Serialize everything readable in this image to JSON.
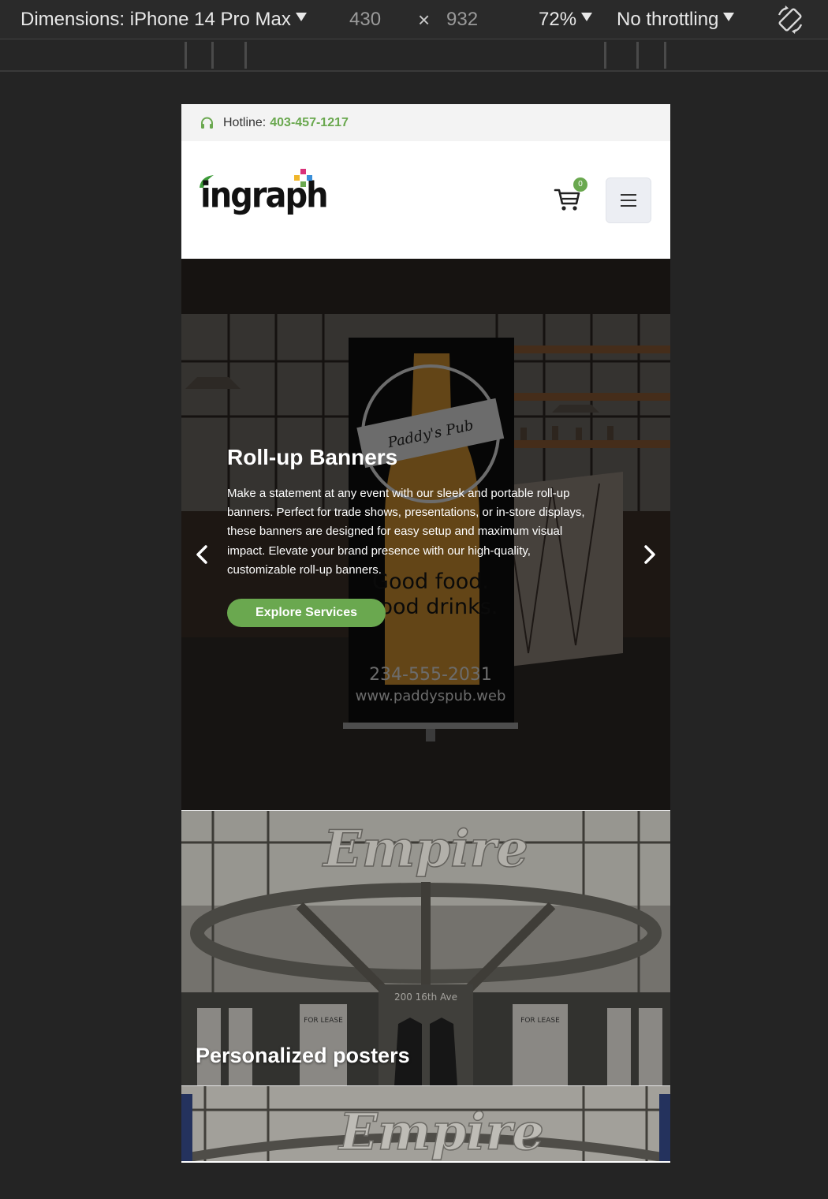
{
  "devtools": {
    "dimensions_label": "Dimensions: iPhone 14 Pro Max",
    "width": "430",
    "times": "×",
    "height": "932",
    "zoom": "72%",
    "throttling": "No throttling"
  },
  "site": {
    "hotline_label": "Hotline:",
    "hotline_number": "403-457-1217",
    "logo_text": "ingraph",
    "cart_count": "0",
    "colors": {
      "accent": "#6aa84f",
      "topbar_bg": "#f3f3f3"
    }
  },
  "hero": {
    "title": "Roll-up Banners",
    "description": "Make a statement at any event with our sleek and portable roll-up banners. Perfect for trade shows, presentations, or in-store displays, these banners are designed for easy setup and maximum visual impact. Elevate your brand presence with our high-quality, customizable roll-up banners.",
    "button_label": "Explore Services",
    "banner_text": {
      "brand": "Paddy's Pub",
      "line1": "Good food.",
      "line2": "Good drinks.",
      "phone": "234-555-2031",
      "url": "www.paddyspub.web"
    }
  },
  "cards": [
    {
      "title": "Personalized posters",
      "sign": "Empire",
      "address": "200 16th Ave",
      "poster_text": "FOR LEASE"
    },
    {
      "title": "",
      "sign": "Empire"
    }
  ]
}
